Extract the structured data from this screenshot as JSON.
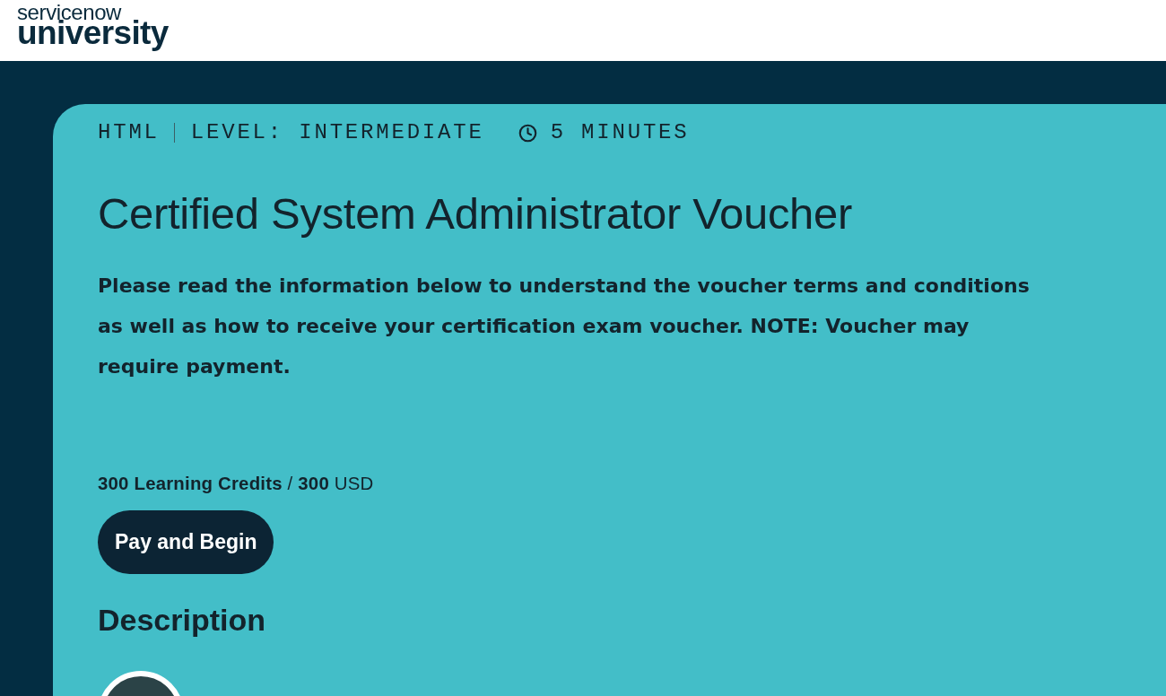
{
  "header": {
    "logo": {
      "top": "servicenow",
      "bottom": "university"
    }
  },
  "course": {
    "meta": [
      {
        "kind": "text",
        "label": "HTML"
      },
      {
        "kind": "divider"
      },
      {
        "kind": "text",
        "label": "LEVEL: INTERMEDIATE"
      },
      {
        "kind": "duration",
        "label": "5 MINUTES"
      }
    ],
    "title": "Certified System Administrator Voucher",
    "intro": "Please read the information below to understand the voucher terms and conditions as well as how to receive your certification exam voucher. NOTE: Voucher may require payment.",
    "price": "**300 Learning Credits** / **300** USD",
    "action": {
      "label": "Pay and Begin"
    },
    "section_heading": "Description"
  }
}
